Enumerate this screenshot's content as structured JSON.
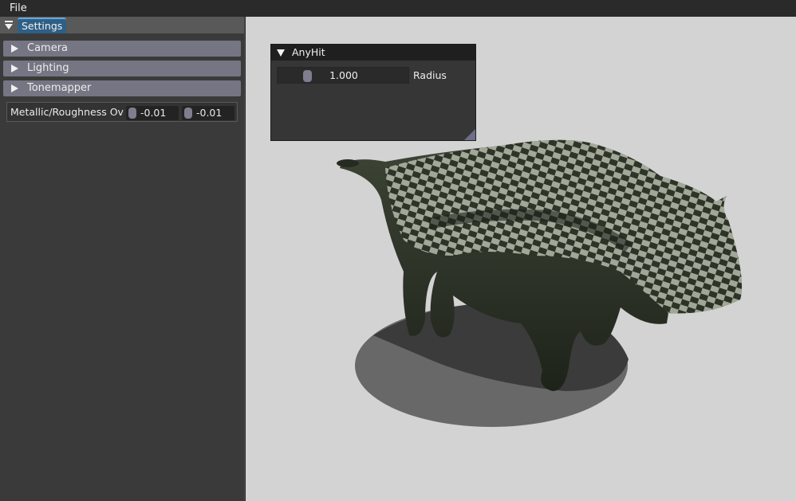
{
  "menubar": {
    "file": "File"
  },
  "tab": {
    "settings": "Settings"
  },
  "sections": {
    "camera": "Camera",
    "lighting": "Lighting",
    "tonemapper": "Tonemapper"
  },
  "override": {
    "label": "Metallic/Roughness Ove",
    "metallic": "-0.01",
    "roughness": "-0.01"
  },
  "anyhit": {
    "title": "AnyHit",
    "radius_value": "1.000",
    "radius_label": "Radius"
  },
  "colors": {
    "tab_active": "#2e5f86",
    "header": "#757583",
    "viewport_bg": "#d3d3d3",
    "model": "#2c3327"
  }
}
